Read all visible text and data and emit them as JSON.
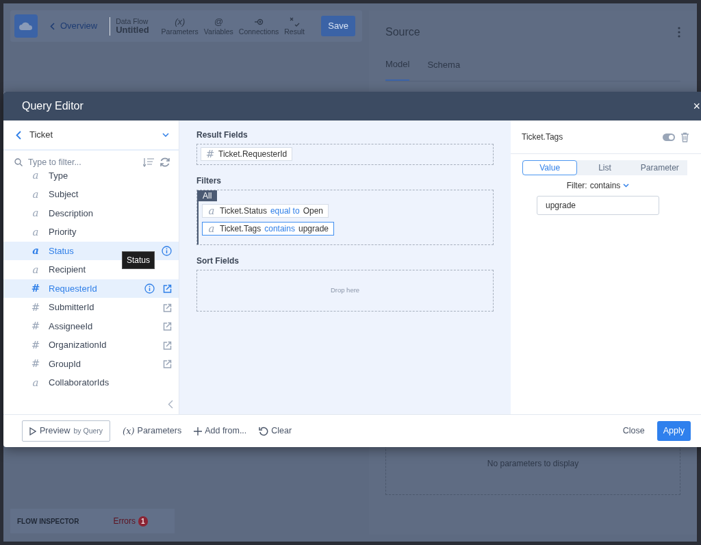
{
  "app": {
    "back_link": "Overview",
    "flow_label": "Data Flow",
    "flow_name": "Untitled",
    "toolbar": [
      {
        "kind": "parameters",
        "symbol": "(x)",
        "label": "Parameters"
      },
      {
        "kind": "variables",
        "symbol": "@",
        "label": "Variables"
      },
      {
        "kind": "connections",
        "label": "Connections"
      },
      {
        "kind": "result",
        "label": "Result"
      }
    ],
    "save": "Save"
  },
  "source_panel": {
    "title": "Source",
    "tabs": [
      {
        "label": "Model",
        "selected": true
      },
      {
        "label": "Schema",
        "selected": false
      }
    ],
    "empty_message": "No parameters to display"
  },
  "flow_inspector": {
    "label": "FLOW INSPECTOR",
    "errors_label": "Errors",
    "errors_count": "1"
  },
  "query_editor": {
    "title": "Query Editor",
    "close": "×",
    "entity": "Ticket",
    "filter_placeholder": "Type to filter...",
    "fields": [
      {
        "symbol": "a",
        "name": "Type",
        "selected": false,
        "info": false,
        "link": false
      },
      {
        "symbol": "a",
        "name": "Subject",
        "selected": false,
        "info": false,
        "link": false
      },
      {
        "symbol": "a",
        "name": "Description",
        "selected": false,
        "info": false,
        "link": false
      },
      {
        "symbol": "a",
        "name": "Priority",
        "selected": false,
        "info": false,
        "link": false
      },
      {
        "symbol": "a",
        "name": "Status",
        "selected": true,
        "info": true,
        "link": false
      },
      {
        "symbol": "a",
        "name": "Recipient",
        "selected": false,
        "info": false,
        "link": false
      },
      {
        "symbol": "#",
        "name": "RequesterId",
        "selected": true,
        "info": true,
        "link": true
      },
      {
        "symbol": "#",
        "name": "SubmitterId",
        "selected": false,
        "info": false,
        "link": true
      },
      {
        "symbol": "#",
        "name": "AssigneeId",
        "selected": false,
        "info": false,
        "link": true
      },
      {
        "symbol": "#",
        "name": "OrganizationId",
        "selected": false,
        "info": false,
        "link": true
      },
      {
        "symbol": "#",
        "name": "GroupId",
        "selected": false,
        "info": false,
        "link": true
      },
      {
        "symbol": "a",
        "name": "CollaboratorIds",
        "selected": false,
        "info": false,
        "link": false
      }
    ],
    "tooltip": "Status",
    "result_fields": {
      "title": "Result Fields",
      "items": [
        {
          "symbol": "#",
          "name": "Ticket.RequesterId"
        }
      ]
    },
    "filters": {
      "title": "Filters",
      "group": "All",
      "items": [
        {
          "symbol": "a",
          "field": "Ticket.Status",
          "operator": "equal to",
          "value": "Open",
          "selected": false
        },
        {
          "symbol": "a",
          "field": "Ticket.Tags",
          "operator": "contains",
          "value": "upgrade",
          "selected": true
        }
      ]
    },
    "sort_fields": {
      "title": "Sort Fields",
      "placeholder": "Drop here"
    },
    "detail": {
      "title": "Ticket.Tags",
      "toggle_on": true,
      "modes": [
        {
          "label": "Value",
          "selected": true
        },
        {
          "label": "List",
          "selected": false
        },
        {
          "label": "Parameter",
          "selected": false
        }
      ],
      "filter_label": "Filter:",
      "filter_value": "contains",
      "value": "upgrade"
    },
    "footer": {
      "preview": "Preview",
      "preview_suffix": "by Query",
      "parameters_symbol": "(x)",
      "parameters": "Parameters",
      "add_from": "Add from...",
      "clear": "Clear",
      "close": "Close",
      "apply": "Apply"
    }
  }
}
